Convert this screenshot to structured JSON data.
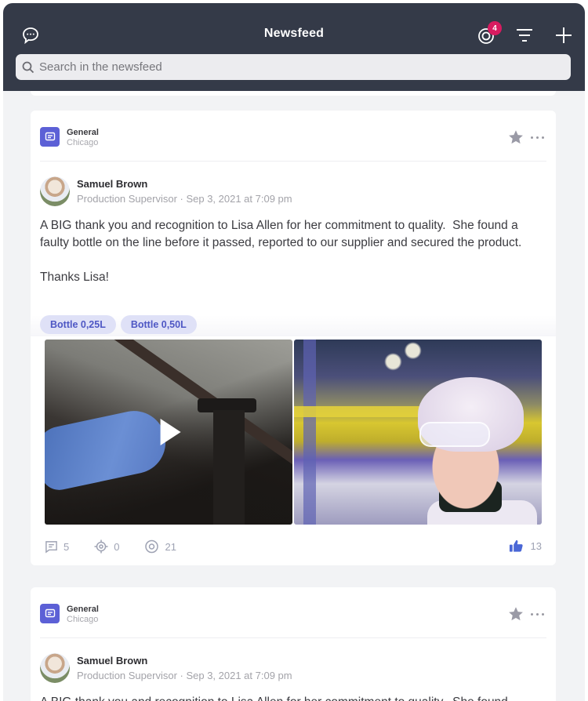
{
  "header": {
    "title": "Newsfeed",
    "notification_count": "4",
    "search_placeholder": "Search in the newsfeed",
    "search_value": ""
  },
  "colors": {
    "header_bg": "#343a48",
    "accent": "#5c60d6",
    "badge": "#d81b60",
    "like": "#4a67d6"
  },
  "posts": [
    {
      "category": "General",
      "location": "Chicago",
      "author": "Samuel Brown",
      "meta": "Production Supervisor · Sep 3, 2021 at 7:09 pm",
      "text": "A BIG thank you and recognition to Lisa Allen for her commitment to quality.  She found a faulty bottle on the line before it passed, reported to our supplier and secured the product.\n\nThanks Lisa!",
      "tags": [
        "Bottle 0,25L",
        "Bottle 0,50L"
      ],
      "media": [
        {
          "type": "video",
          "icon": "play-icon"
        },
        {
          "type": "photo"
        }
      ],
      "stats": {
        "comments": "5",
        "mentions": "0",
        "views": "21",
        "likes": "13"
      }
    },
    {
      "category": "General",
      "location": "Chicago",
      "author": "Samuel Brown",
      "meta": "Production Supervisor · Sep 3, 2021 at 7:09 pm",
      "text": "A BIG thank you and recognition to Lisa Allen for her commitment to quality.  She found"
    }
  ]
}
